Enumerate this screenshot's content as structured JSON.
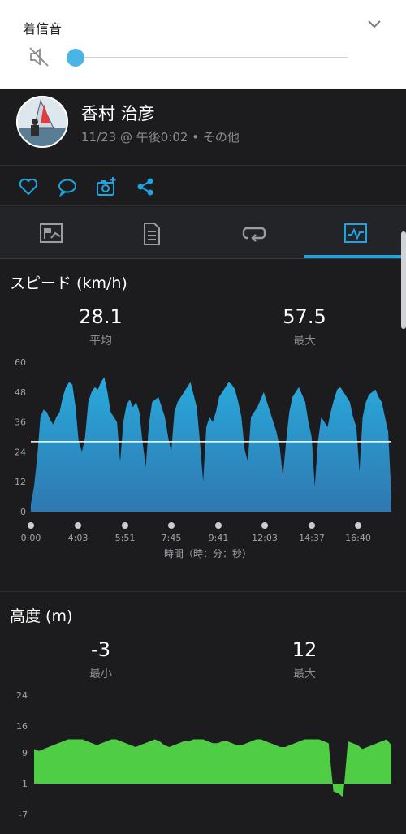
{
  "volume": {
    "title": "着信音",
    "level": 0,
    "icons": {
      "mute": "speaker-muted-icon",
      "expand": "chevron-down-icon"
    },
    "accent_color": "#4bb4e6"
  },
  "post": {
    "user_name": "香村 治彦",
    "meta": "11/23 @ 午後0:02 • その他"
  },
  "actions": [
    {
      "name": "like",
      "icon": "heart-icon"
    },
    {
      "name": "comment",
      "icon": "comment-icon"
    },
    {
      "name": "add-photo",
      "icon": "camera-plus-icon"
    },
    {
      "name": "share",
      "icon": "share-icon"
    }
  ],
  "tabs": [
    {
      "name": "overview",
      "icon": "flag-map-icon",
      "active": false
    },
    {
      "name": "details",
      "icon": "document-icon",
      "active": false
    },
    {
      "name": "laps",
      "icon": "loop-icon",
      "active": false
    },
    {
      "name": "charts",
      "icon": "chart-icon",
      "active": true
    }
  ],
  "speed": {
    "title": "スピード (km/h)",
    "avg_value": "28.1",
    "avg_label": "平均",
    "max_value": "57.5",
    "max_label": "最大"
  },
  "elevation": {
    "title": "高度 (m)",
    "min_value": "-3",
    "min_label": "最小",
    "max_value": "12",
    "max_label": "最大"
  },
  "chart_data": [
    {
      "type": "area",
      "y_ticks": [
        "60",
        "48",
        "36",
        "24",
        "12",
        "0"
      ],
      "ylim": [
        0,
        60
      ],
      "x_ticks": [
        "0:00",
        "4:03",
        "5:51",
        "7:45",
        "9:41",
        "12:03",
        "14:37",
        "16:40"
      ],
      "xlabel": "時間（時：分：秒）",
      "average_line": 28.1,
      "fill_top": "#29a9dc",
      "fill_bottom": "#2f78b0",
      "values": [
        3,
        10,
        22,
        38,
        41,
        40,
        37,
        35,
        38,
        40,
        46,
        50,
        52,
        51,
        42,
        28,
        24,
        30,
        44,
        48,
        50,
        49,
        52,
        54,
        48,
        40,
        38,
        36,
        20,
        36,
        43,
        45,
        42,
        44,
        40,
        28,
        18,
        35,
        44,
        45,
        46,
        42,
        38,
        30,
        24,
        40,
        44,
        46,
        48,
        50,
        52,
        47,
        42,
        28,
        12,
        34,
        38,
        36,
        40,
        46,
        48,
        50,
        52,
        51,
        49,
        44,
        38,
        25,
        20,
        38,
        40,
        42,
        45,
        48,
        44,
        40,
        36,
        32,
        26,
        14,
        28,
        40,
        46,
        48,
        50,
        47,
        44,
        36,
        30,
        10,
        28,
        38,
        36,
        34,
        40,
        45,
        49,
        50,
        48,
        46,
        44,
        38,
        34,
        16,
        38,
        44,
        47,
        48,
        49,
        46,
        44,
        38,
        32,
        6
      ]
    },
    {
      "type": "area",
      "y_ticks": [
        "24",
        "16",
        "9",
        "1",
        "-7"
      ],
      "ylim": [
        -7,
        24
      ],
      "fill": "#4fce45",
      "values": [
        10,
        9.5,
        10,
        10.5,
        11,
        11.5,
        12,
        12.5,
        12.5,
        12.5,
        12.5,
        12,
        11.5,
        11,
        11.5,
        12,
        12.5,
        12.5,
        12,
        11.5,
        11,
        10.5,
        11,
        11.5,
        12,
        12.5,
        12,
        11,
        10.5,
        11,
        11.5,
        12,
        12,
        12.5,
        12.5,
        12.5,
        12,
        11.5,
        11.5,
        12,
        12,
        11.5,
        11,
        11,
        11.5,
        12,
        12.5,
        12.5,
        12,
        11.5,
        11,
        10.5,
        10.5,
        11,
        11.5,
        12,
        12.5,
        12.5,
        12.5,
        12.5,
        12,
        11.5,
        -1,
        -1.5,
        -2.5,
        12,
        11.5,
        11,
        10,
        10.5,
        11,
        11.5,
        12,
        12.5,
        11
      ]
    }
  ]
}
